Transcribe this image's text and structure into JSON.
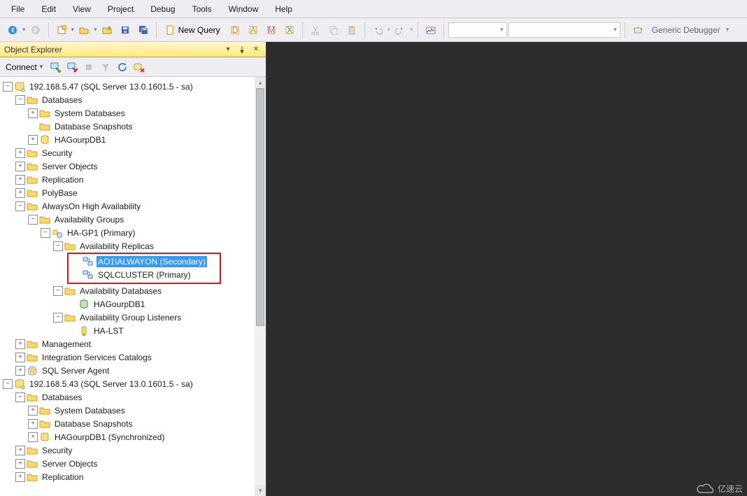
{
  "menu": {
    "items": [
      "File",
      "Edit",
      "View",
      "Project",
      "Debug",
      "Tools",
      "Window",
      "Help"
    ]
  },
  "toolbar": {
    "new_query": "New Query",
    "generic_debugger": "Generic Debugger"
  },
  "object_explorer": {
    "title": "Object Explorer",
    "connect": "Connect",
    "server1": {
      "root": "192.168.5.47 (SQL Server 13.0.1601.5 - sa)",
      "databases": "Databases",
      "sysdb": "System Databases",
      "dbsnap": "Database Snapshots",
      "hagourpdb": "HAGourpDB1",
      "security": "Security",
      "serverobjects": "Server Objects",
      "replication": "Replication",
      "polybase": "PolyBase",
      "alwayson": "AlwaysOn High Availability",
      "ag": "Availability Groups",
      "hagp1": "HA-GP1 (Primary)",
      "ar": "Availability Replicas",
      "replica1": "AO1\\ALWAYON (Secondary)",
      "replica2": "SQLCLUSTER (Primary)",
      "adb": "Availability Databases",
      "adb1": "HAGourpDB1",
      "agl": "Availability Group Listeners",
      "halst": "HA-LST",
      "management": "Management",
      "isc": "Integration Services Catalogs",
      "agent": "SQL Server Agent"
    },
    "server2": {
      "root": "192.168.5.43 (SQL Server 13.0.1601.5 - sa)",
      "databases": "Databases",
      "sysdb": "System Databases",
      "dbsnap": "Database Snapshots",
      "hagourpdb": "HAGourpDB1 (Synchronized)",
      "security": "Security",
      "serverobjects": "Server Objects",
      "replication": "Replication"
    }
  },
  "watermark": "亿速云"
}
